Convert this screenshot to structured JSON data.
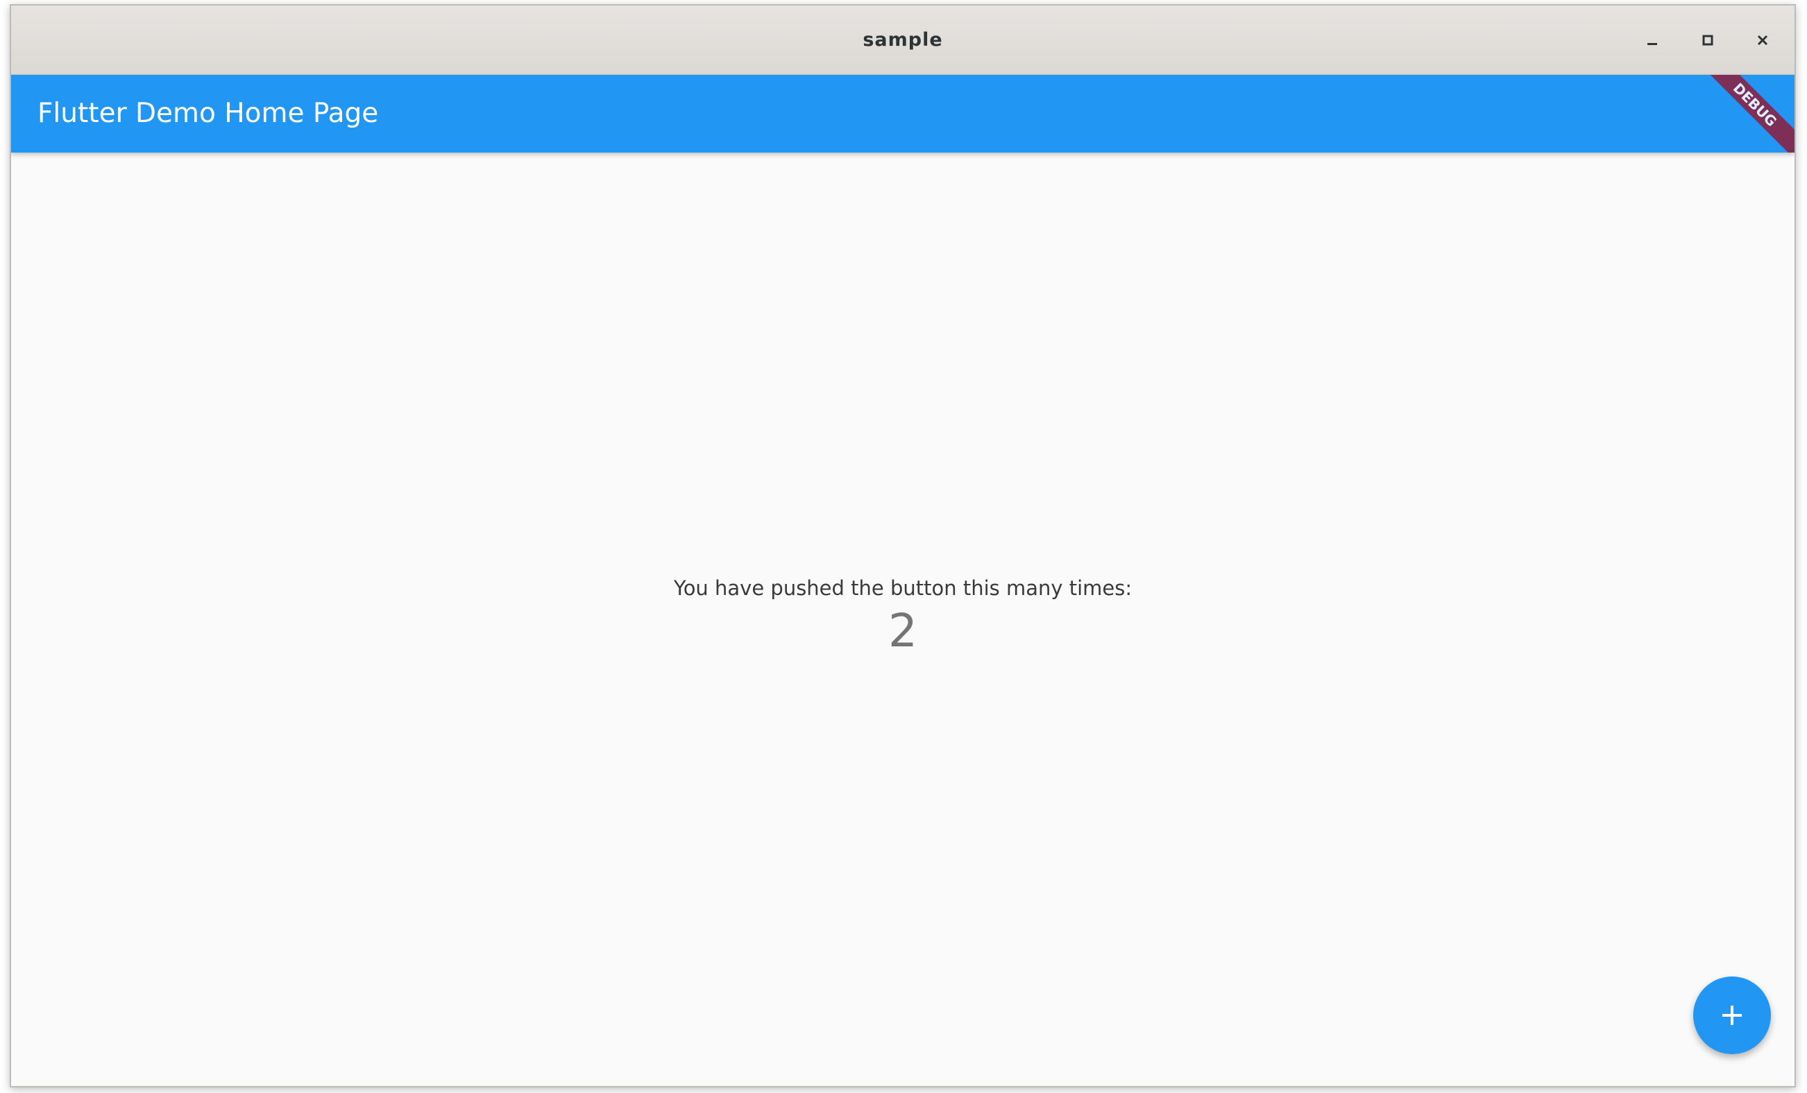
{
  "window": {
    "title": "sample"
  },
  "appbar": {
    "title": "Flutter Demo Home Page",
    "debug_banner": "DEBUG"
  },
  "main": {
    "counter_label": "You have pushed the button this many times:",
    "counter_value": "2"
  },
  "icons": {
    "minimize": "minimize-icon",
    "maximize": "maximize-icon",
    "close": "close-icon",
    "fab": "plus-icon"
  },
  "colors": {
    "primary": "#2196f3",
    "debug_banner": "#8f1e3e",
    "background": "#fafafa",
    "titlebar": "#dedbd7"
  }
}
